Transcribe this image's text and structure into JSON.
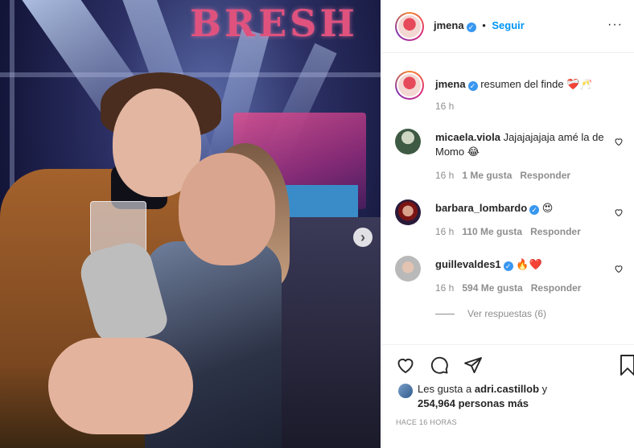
{
  "photo": {
    "stage_sign": "BRESH",
    "next_glyph": "›"
  },
  "header": {
    "username": "jmena",
    "verified_glyph": "✓",
    "dot": "•",
    "follow_label": "Seguir",
    "more_glyph": "···"
  },
  "caption": {
    "username": "jmena",
    "text": "resumen del finde",
    "emoji": "❤️‍🩹🥂",
    "time": "16 h"
  },
  "comments": [
    {
      "username": "micaela.viola",
      "text": "Jajajajajaja amé la de Momo",
      "emoji": "😂",
      "time": "16 h",
      "likes": "1 Me gusta",
      "reply": "Responder",
      "verified": false
    },
    {
      "username": "barbara_lombardo",
      "text": "",
      "emoji": "😍",
      "time": "16 h",
      "likes": "110 Me gusta",
      "reply": "Responder",
      "verified": true
    },
    {
      "username": "guillevaldes1",
      "text": "",
      "emoji": "🔥❤️",
      "time": "16 h",
      "likes": "594 Me gusta",
      "reply": "Responder",
      "verified": true
    }
  ],
  "replies_label": "Ver respuestas (6)",
  "likes": {
    "prefix": "Les gusta a",
    "user": "adri.castillob",
    "connector": "y",
    "count": "254,964 personas más"
  },
  "timestamp": "HACE 16 HORAS",
  "colors": {
    "link": "#0095f6",
    "muted": "#8e8e8e",
    "verified": "#3897f0"
  }
}
